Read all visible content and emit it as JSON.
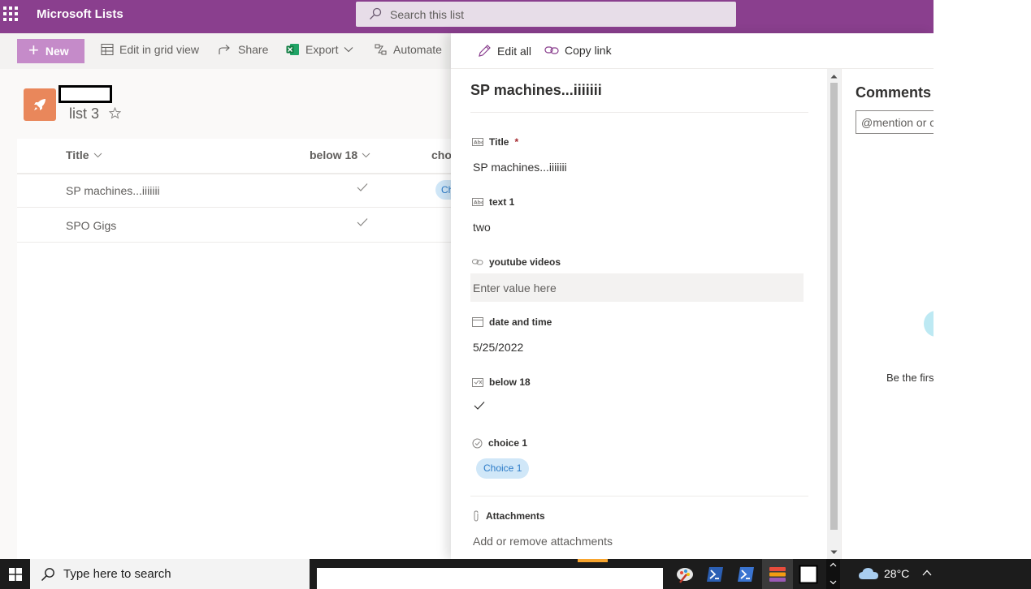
{
  "suitebar": {
    "app_name": "Microsoft Lists",
    "search_placeholder": "Search this list"
  },
  "commandbar": {
    "new_label": "New",
    "edit_grid_label": "Edit in grid view",
    "share_label": "Share",
    "export_label": "Export",
    "automate_label": "Automate"
  },
  "list": {
    "name": "list 3",
    "columns": {
      "title": "Title",
      "below18": "below 18",
      "choice_partial": "cho"
    },
    "rows": [
      {
        "title": "SP machines...iiiiiii",
        "below18": true,
        "choice_partial": "Ch"
      },
      {
        "title": "SPO Gigs",
        "below18": true,
        "choice_partial": ""
      }
    ]
  },
  "panel": {
    "edit_all_label": "Edit all",
    "copy_link_label": "Copy link",
    "item_title": "SP machines...iiiiiii",
    "fields": {
      "title": {
        "label": "Title",
        "required_mark": "*",
        "value": "SP machines...iiiiiii"
      },
      "text1": {
        "label": "text 1",
        "value": "two"
      },
      "youtube": {
        "label": "youtube videos",
        "placeholder": "Enter value here"
      },
      "datetime": {
        "label": "date and time",
        "value": "5/25/2022"
      },
      "below18": {
        "label": "below 18",
        "checked": true
      },
      "choice1": {
        "label": "choice 1",
        "value": "Choice 1"
      }
    },
    "attachments": {
      "label": "Attachments",
      "link": "Add or remove attachments"
    }
  },
  "comments": {
    "title": "Comments",
    "input_placeholder": "@mention or c",
    "empty_text": "Be the firs"
  },
  "taskbar": {
    "search_text": "Type here to search",
    "weather": "28°C"
  },
  "colors": {
    "suitebar": "#8a3f8e",
    "new_button": "#c58bc9",
    "list_icon": "#e9875b",
    "chip_bg": "#d0e7f8",
    "chip_text": "#2d7cc8"
  }
}
